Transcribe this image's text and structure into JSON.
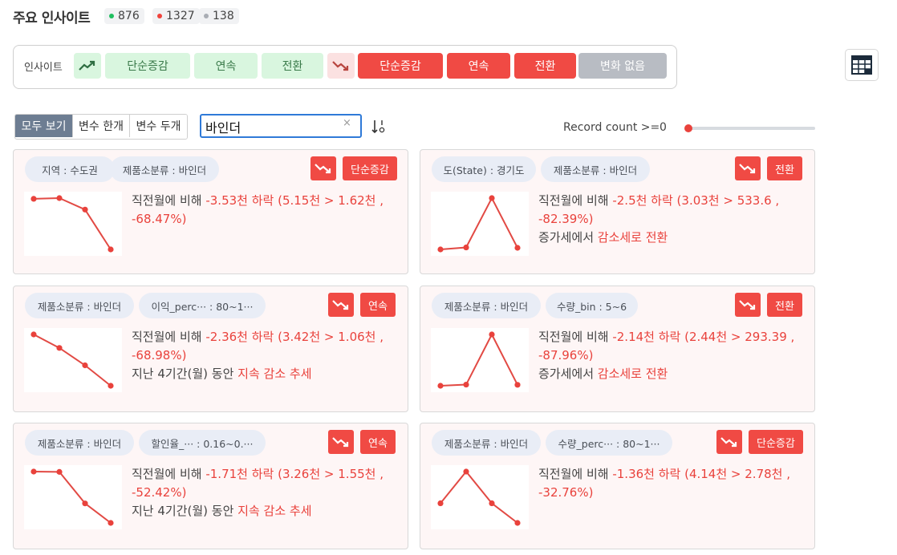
{
  "header": {
    "title": "주요 인사이트",
    "counts": [
      {
        "value": "876",
        "color": "#1fbf5f"
      },
      {
        "value": "1327",
        "color": "#f0433c"
      },
      {
        "value": "138",
        "color": "#a9adb4"
      }
    ]
  },
  "filters": {
    "label": "인사이트",
    "up_icon": "trend-up-icon",
    "down_icon": "trend-down-icon",
    "up_items": [
      "단순증감",
      "연속",
      "전환"
    ],
    "down_items": [
      "단순증감",
      "연속",
      "전환"
    ],
    "neutral_item": "변화 없음"
  },
  "view_tabs": [
    "모두 보기",
    "변수 한개",
    "변수 두개"
  ],
  "search": {
    "value": "바인더",
    "clear": "×"
  },
  "record_count": {
    "label": "Record count >=",
    "value": "0"
  },
  "colors": {
    "up": "#d9f6df",
    "down": "#f04a44",
    "neutral": "#b8bcc3",
    "accent": "#2f7ad8"
  },
  "cards": [
    {
      "tags": [
        "지역 : 수도권",
        "제품소분류 : 바인더"
      ],
      "badge": "단순증감",
      "line1_prefix": "직전월에 비해 ",
      "change": "-3.53천 하락",
      "detail": " (5.15천  >  1.62천 ,",
      "pct": "-68.47%)",
      "line3_prefix": "",
      "line3_em": "",
      "spark": [
        5.15,
        5.2,
        4.4,
        1.62
      ]
    },
    {
      "tags": [
        "도(State) : 경기도",
        "제품소분류 : 바인더"
      ],
      "badge": "전환",
      "line1_prefix": "직전월에 비해 ",
      "change": "-2.5천 하락",
      "detail": " (3.03천  >  533.6 ,",
      "pct": "-82.39%)",
      "line3_prefix": "증가세에서 ",
      "line3_em": "감소세로 전환",
      "spark": [
        0.45,
        0.55,
        3.03,
        0.53
      ]
    },
    {
      "tags": [
        "제품소분류 : 바인더",
        "이익_perc···   : 80~1···"
      ],
      "badge": "연속",
      "line1_prefix": "직전월에 비해 ",
      "change": "-2.36천 하락",
      "detail": " (3.42천  >  1.06천 ,",
      "pct": "-68.98%)",
      "line3_prefix": "지난 4기간(월) 동안 ",
      "line3_em": "지속 감소 추세",
      "spark": [
        3.42,
        2.8,
        2.0,
        1.06
      ]
    },
    {
      "tags": [
        "제품소분류 : 바인더",
        "수량_bin : 5~6"
      ],
      "badge": "전환",
      "line1_prefix": "직전월에 비해 ",
      "change": "-2.14천 하락",
      "detail": " (2.44천  >  293.39 ,",
      "pct": "-87.96%)",
      "line3_prefix": "증가세에서 ",
      "line3_em": "감소세로 전환",
      "spark": [
        0.25,
        0.3,
        2.44,
        0.29
      ]
    },
    {
      "tags": [
        "제품소분류 : 바인더",
        "할인율_···   : 0.16~0.···"
      ],
      "badge": "연속",
      "line1_prefix": "직전월에 비해 ",
      "change": "-1.71천 하락",
      "detail": " (3.26천  >  1.55천 ,",
      "pct": "-52.42%)",
      "line3_prefix": "지난 4기간(월) 동안 ",
      "line3_em": "지속 감소 추세",
      "spark": [
        3.26,
        3.25,
        2.2,
        1.55
      ]
    },
    {
      "tags": [
        "제품소분류 : 바인더",
        "수량_perc···   : 80~1···"
      ],
      "badge": "단순증감",
      "line1_prefix": "직전월에 비해 ",
      "change": "-1.36천 하락",
      "detail": " (4.14천  >  2.78천 ,",
      "pct": "-32.76%)",
      "line3_prefix": "",
      "line3_em": "",
      "spark": [
        3.3,
        4.14,
        3.3,
        2.78
      ]
    }
  ]
}
